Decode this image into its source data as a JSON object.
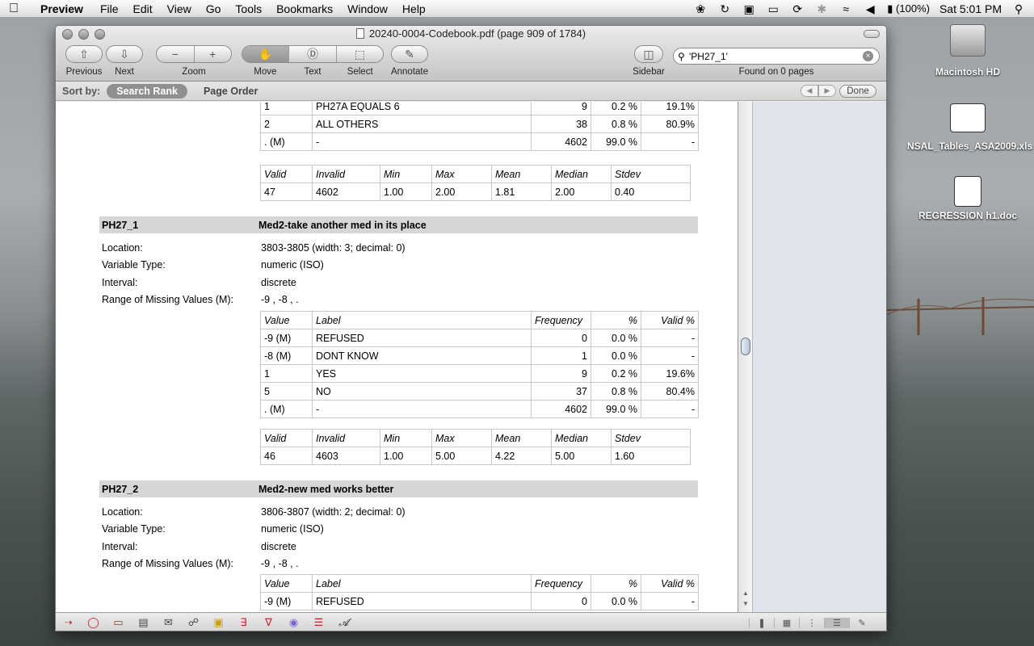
{
  "menubar": {
    "app_name": "Preview",
    "menus": [
      "File",
      "Edit",
      "View",
      "Go",
      "Tools",
      "Bookmarks",
      "Window",
      "Help"
    ],
    "battery": "(100%)",
    "clock": "Sat 5:01 PM"
  },
  "desktop": {
    "icons": [
      {
        "label": "Macintosh HD"
      },
      {
        "label": "NSAL_Tables_ASA2009.xls"
      },
      {
        "label": "REGRESSION h1.doc"
      }
    ]
  },
  "window": {
    "title": "20240-0004-Codebook.pdf (page 909 of 1784)",
    "toolbar": {
      "previous": "Previous",
      "next": "Next",
      "zoom": "Zoom",
      "move": "Move",
      "text": "Text",
      "select": "Select",
      "annotate": "Annotate",
      "sidebar": "Sidebar",
      "search_value": "'PH27_1'",
      "found": "Found on 0 pages"
    },
    "sortbar": {
      "label": "Sort by:",
      "search_rank": "Search Rank",
      "page_order": "Page Order",
      "done": "Done"
    }
  },
  "document": {
    "top_freq_rows": [
      [
        "1",
        "PH27A EQUALS 6",
        "9",
        "0.2 %",
        "19.1%"
      ],
      [
        "2",
        "ALL OTHERS",
        "38",
        "0.8 %",
        "80.9%"
      ],
      [
        ". (M)",
        "-",
        "4602",
        "99.0 %",
        "-"
      ]
    ],
    "stats_header": [
      "Valid",
      "Invalid",
      "Min",
      "Max",
      "Mean",
      "Median",
      "Stdev"
    ],
    "top_stats": [
      "47",
      "4602",
      "1.00",
      "2.00",
      "1.81",
      "2.00",
      "0.40"
    ],
    "freq_header": [
      "Value",
      "Label",
      "Frequency",
      "%",
      "Valid %"
    ],
    "info_labels": {
      "location": "Location:",
      "type": "Variable Type:",
      "interval": "Interval:",
      "missing": "Range of Missing Values (M):"
    },
    "var1": {
      "name": "PH27_1",
      "desc": "Med2-take another med in its place",
      "location": "3803-3805 (width: 3; decimal: 0)",
      "type": "numeric  (ISO)",
      "interval": "discrete",
      "missing": "-9 , -8 , .",
      "freq_rows": [
        [
          "-9 (M)",
          "REFUSED",
          "0",
          "0.0 %",
          "-"
        ],
        [
          "-8 (M)",
          "DONT KNOW",
          "1",
          "0.0 %",
          "-"
        ],
        [
          "1",
          "YES",
          "9",
          "0.2 %",
          "19.6%"
        ],
        [
          "5",
          "NO",
          "37",
          "0.8 %",
          "80.4%"
        ],
        [
          ". (M)",
          "-",
          "4602",
          "99.0 %",
          "-"
        ]
      ],
      "stats": [
        "46",
        "4603",
        "1.00",
        "5.00",
        "4.22",
        "5.00",
        "1.60"
      ]
    },
    "var2": {
      "name": "PH27_2",
      "desc": "Med2-new med works better",
      "location": "3806-3807 (width: 2; decimal: 0)",
      "type": "numeric  (ISO)",
      "interval": "discrete",
      "missing": "-9 , -8 , .",
      "freq_rows": [
        [
          "-9 (M)",
          "REFUSED",
          "0",
          "0.0 %",
          "-"
        ]
      ]
    }
  }
}
